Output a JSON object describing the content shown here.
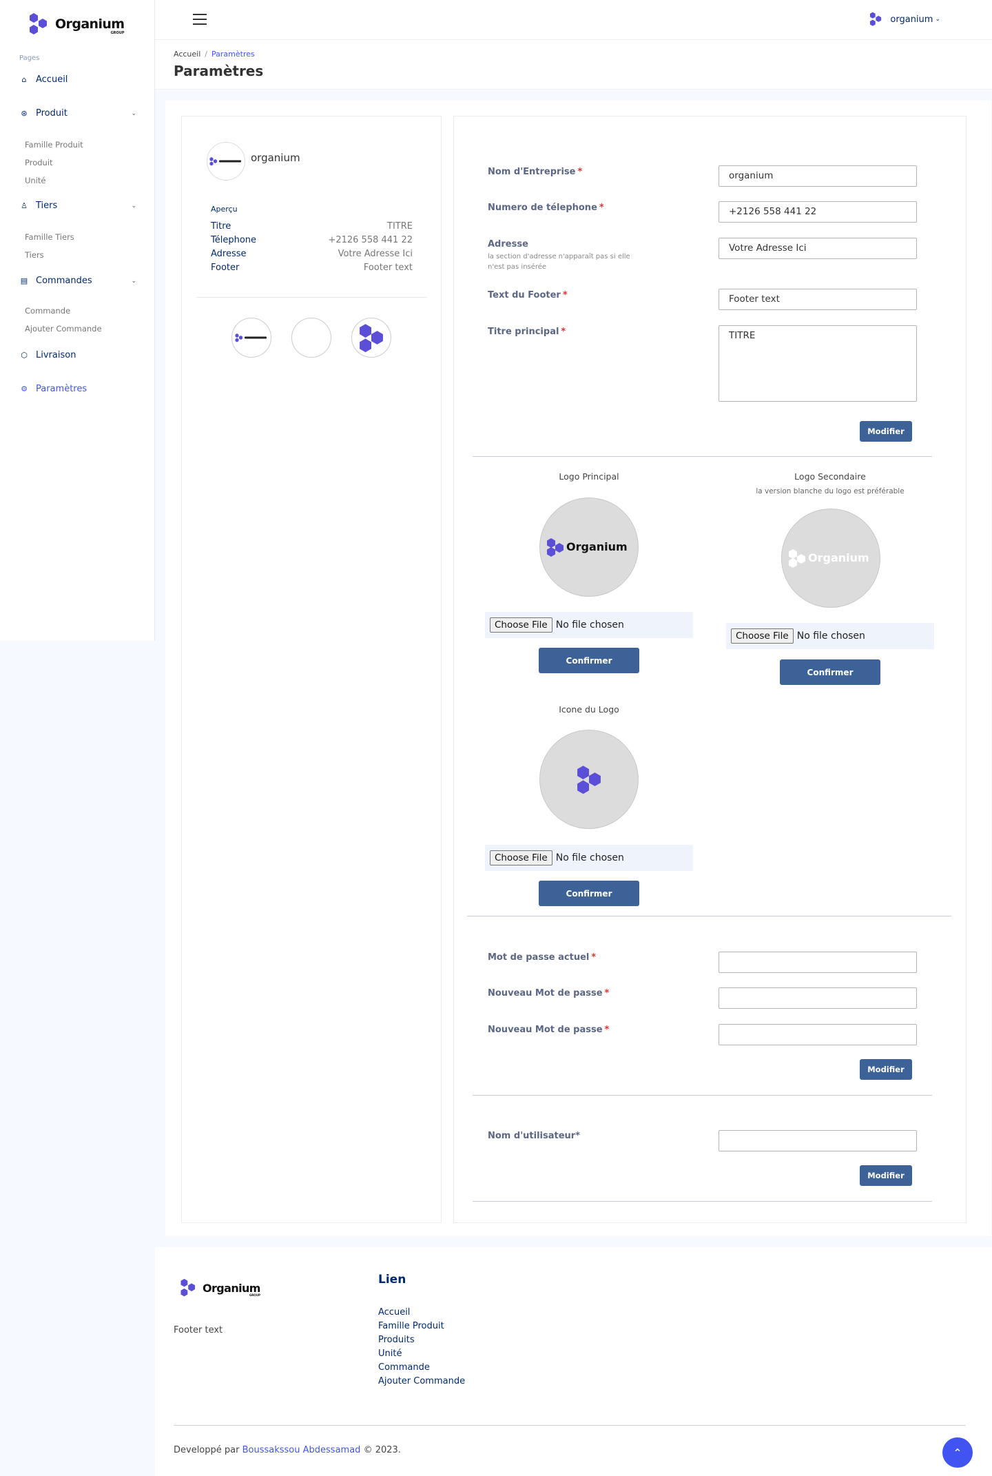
{
  "brand": {
    "name": "Organium",
    "sub": "GROUP",
    "color": "#5b4fd8"
  },
  "sidebar": {
    "heading": "Pages",
    "items": [
      {
        "label": "Accueil",
        "icon": "home-icon"
      },
      {
        "label": "Produit",
        "icon": "box-icon"
      },
      {
        "label": "Tiers",
        "icon": "user-icon"
      },
      {
        "label": "Commandes",
        "icon": "calendar-icon"
      },
      {
        "label": "Livraison",
        "icon": "truck-icon"
      },
      {
        "label": "Paramètres",
        "icon": "gear-icon"
      }
    ],
    "produit_sub": [
      "Famille Produit",
      "Produit",
      "Unité"
    ],
    "tiers_sub": [
      "Famille Tiers",
      "Tiers"
    ],
    "commandes_sub": [
      "Commande",
      "Ajouter Commande"
    ]
  },
  "header": {
    "profile_name": "organium"
  },
  "breadcrumb": {
    "home": "Accueil",
    "current": "Paramètres"
  },
  "page_title": "Paramètres",
  "preview": {
    "company": "organium",
    "heading": "Aperçu",
    "rows": [
      {
        "k": "Titre",
        "v": "TITRE"
      },
      {
        "k": "Télephone",
        "v": "+2126 558 441 22"
      },
      {
        "k": "Adresse",
        "v": "Votre Adresse Ici"
      },
      {
        "k": "Footer",
        "v": "Footer text"
      }
    ]
  },
  "form": {
    "company_label": "Nom d'Entreprise",
    "company_value": "organium",
    "phone_label": "Numero de télephone",
    "phone_value": "+2126 558 441 22",
    "address_label": "Adresse",
    "address_hint": "la section d'adresse n'apparaît pas si elle n'est pas insérée",
    "address_value": "Votre Adresse Ici",
    "footer_label": "Text du Footer",
    "footer_value": "Footer text",
    "title_label": "Titre principal",
    "title_value": "TITRE",
    "required_mark": "*",
    "modify_label": "Modifier"
  },
  "logos": {
    "main_title": "Logo Principal",
    "secondary_title": "Logo Secondaire",
    "secondary_hint": "la version blanche du logo est préférable",
    "icon_title": "Icone du Logo",
    "choose_file": "Choose File",
    "no_file": "No file chosen",
    "confirm": "Confirmer"
  },
  "password": {
    "current_label": "Mot de passe actuel",
    "new_label": "Nouveau Mot de passe",
    "confirm_label": "Nouveau Mot de passe"
  },
  "username": {
    "label": "Nom d'utilisateur*"
  },
  "footer": {
    "text": "Footer text",
    "links_heading": "Lien",
    "links": [
      "Accueil",
      "Famille Produit",
      "Produits",
      "Unité",
      "Commande",
      "Ajouter Commande"
    ],
    "copyright_prefix": "Developpé par",
    "author": "Boussakssou Abdessamad",
    "copyright_suffix": "© 2023."
  }
}
